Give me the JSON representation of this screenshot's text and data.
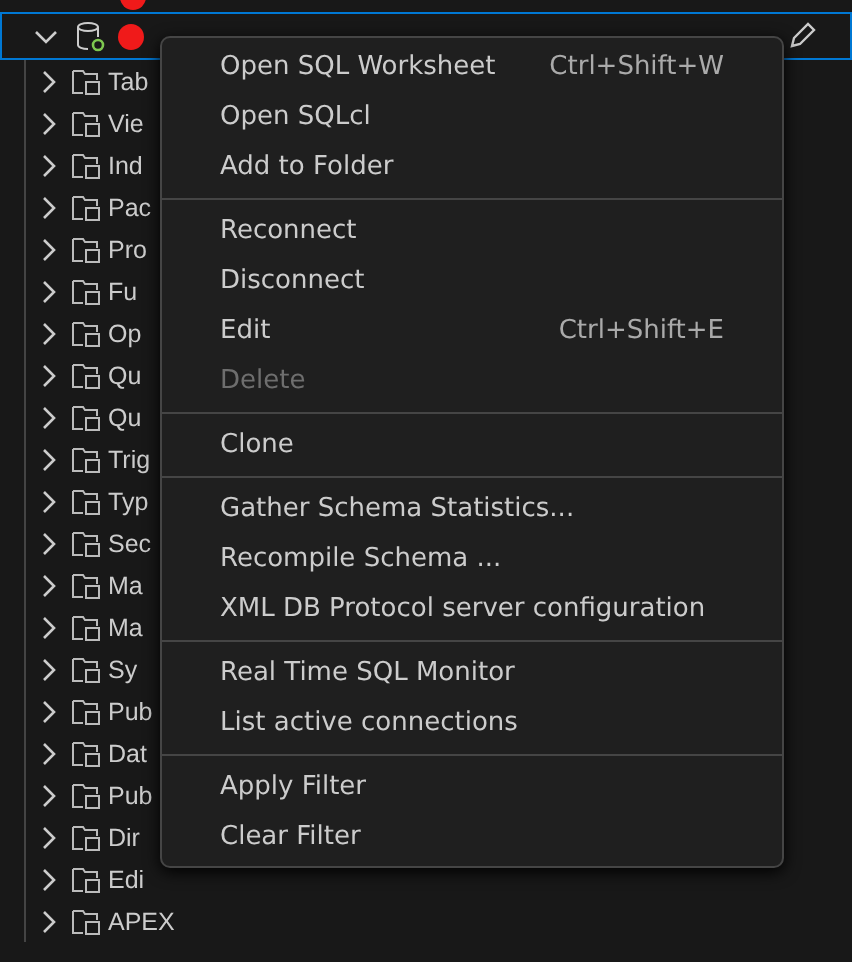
{
  "tree": {
    "connection": {
      "expanded": true,
      "selected": true
    },
    "items": [
      {
        "label": "Tab"
      },
      {
        "label": "Vie"
      },
      {
        "label": "Ind"
      },
      {
        "label": "Pac"
      },
      {
        "label": "Pro"
      },
      {
        "label": "Fu"
      },
      {
        "label": "Op"
      },
      {
        "label": "Qu"
      },
      {
        "label": "Qu"
      },
      {
        "label": "Trig"
      },
      {
        "label": "Typ"
      },
      {
        "label": "Sec"
      },
      {
        "label": "Ma"
      },
      {
        "label": "Ma"
      },
      {
        "label": "Sy"
      },
      {
        "label": "Pub"
      },
      {
        "label": "Dat"
      },
      {
        "label": "Pub"
      },
      {
        "label": "Dir"
      },
      {
        "label": "Edi"
      },
      {
        "label": "APEX"
      }
    ]
  },
  "context_menu": [
    {
      "kind": "item",
      "label": "Open SQL Worksheet",
      "shortcut": "Ctrl+Shift+W",
      "disabled": false
    },
    {
      "kind": "item",
      "label": "Open SQLcl",
      "disabled": false
    },
    {
      "kind": "item",
      "label": "Add to Folder",
      "disabled": false
    },
    {
      "kind": "separator"
    },
    {
      "kind": "item",
      "label": "Reconnect",
      "disabled": false
    },
    {
      "kind": "item",
      "label": "Disconnect",
      "disabled": false
    },
    {
      "kind": "item",
      "label": "Edit",
      "shortcut": "Ctrl+Shift+E",
      "disabled": false
    },
    {
      "kind": "item",
      "label": "Delete",
      "disabled": true
    },
    {
      "kind": "separator"
    },
    {
      "kind": "item",
      "label": "Clone",
      "disabled": false
    },
    {
      "kind": "separator"
    },
    {
      "kind": "item",
      "label": "Gather Schema Statistics...",
      "disabled": false
    },
    {
      "kind": "item",
      "label": "Recompile Schema ...",
      "disabled": false
    },
    {
      "kind": "item",
      "label": "XML DB Protocol server configuration",
      "disabled": false
    },
    {
      "kind": "separator"
    },
    {
      "kind": "item",
      "label": "Real Time SQL Monitor",
      "disabled": false
    },
    {
      "kind": "item",
      "label": "List active connections",
      "disabled": false
    },
    {
      "kind": "separator"
    },
    {
      "kind": "item",
      "label": "Apply Filter",
      "disabled": false
    },
    {
      "kind": "item",
      "label": "Clear Filter",
      "disabled": false
    }
  ]
}
